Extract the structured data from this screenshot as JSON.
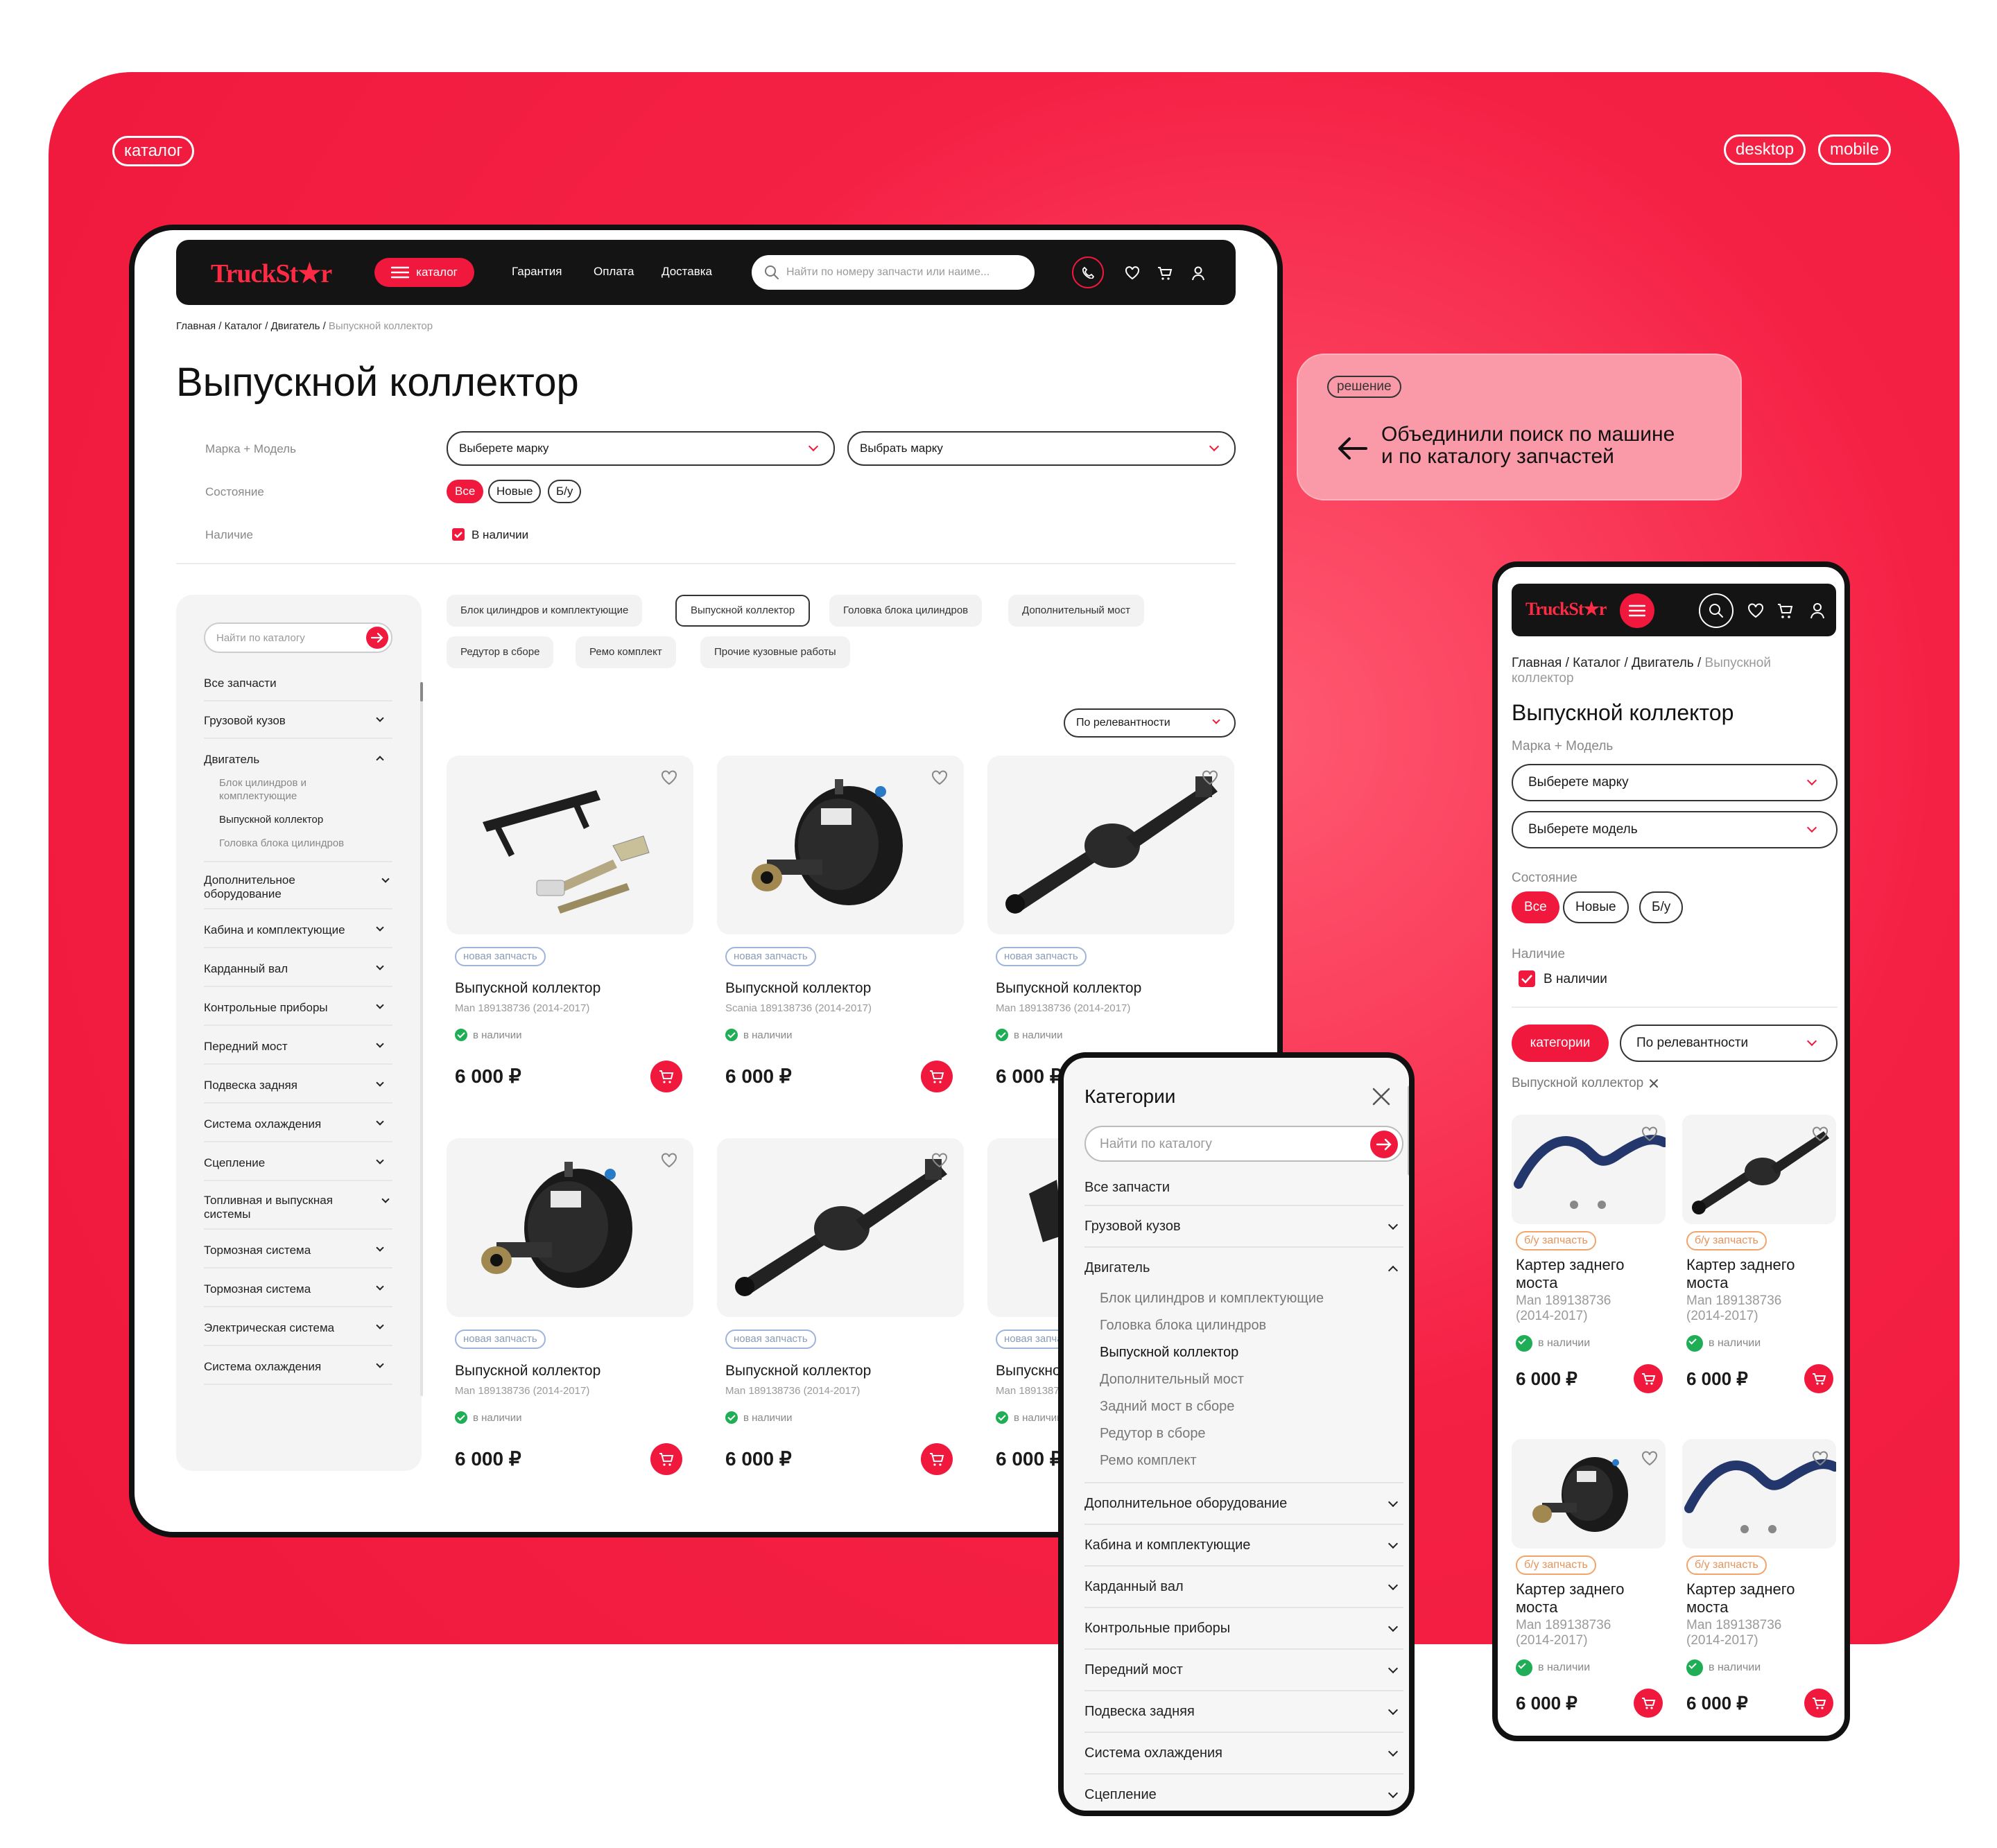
{
  "hero": {
    "tag_catalog": "каталог",
    "tag_desktop": "desktop",
    "tag_mobile": "mobile"
  },
  "callout": {
    "tag": "решение",
    "text_line1": "Объединили поиск по машине",
    "text_line2": "и по каталогу запчастей"
  },
  "brand": {
    "logo": "TruckSt★r",
    "accent": "#f0183c",
    "dark": "#141414"
  },
  "desktop": {
    "header": {
      "catalog_label": "каталог",
      "nav": [
        "Гарантия",
        "Оплата",
        "Доставка"
      ],
      "search_placeholder": "Найти по номеру запчасти или наиме..."
    },
    "breadcrumb": {
      "links": "Главная / Каталог / Двигатель /",
      "current": " Выпускной коллектор"
    },
    "title": "Выпускной коллектор",
    "filters": {
      "brand_model_label": "Марка + Модель",
      "brand_select": "Выберете марку",
      "model_select": "Выбрать марку",
      "condition_label": "Состояние",
      "condition_options": [
        "Все",
        "Новые",
        "Б/у"
      ],
      "availability_label": "Наличие",
      "availability_option": "В наличии"
    },
    "sidebar": {
      "search_placeholder": "Найти по каталогу",
      "all_parts": "Все запчасти",
      "items": [
        "Грузовой кузов",
        "Двигатель",
        "Дополнительное оборудование",
        "Кабина и комплектующие",
        "Карданный вал",
        "Контрольные приборы",
        "Передний мост",
        "Подвеска задняя",
        "Система охлаждения",
        "Сцепление",
        "Топливная и выпускная системы",
        "Тормозная система",
        "Тормозная система",
        "Электрическая система",
        "Система охлаждения"
      ],
      "engine_sub": [
        "Блок цилиндров и комплектующие",
        "Выпускной коллектор",
        "Головка блока цилиндров"
      ]
    },
    "chips": [
      "Блок цилиндров и комплектующие",
      "Выпускной коллектор",
      "Головка блока цилиндров",
      "Дополнительный мост",
      "Редутор в сборе",
      "Ремо комплект",
      "Прочие кузовные работы"
    ],
    "sort": "По релевантности",
    "products": [
      {
        "tag": "новая запчасть",
        "title": "Выпускной коллектор",
        "sub": "Man 189138736 (2014-2017)",
        "avail": "в наличии",
        "price": "6 000 ₽"
      },
      {
        "tag": "новая запчасть",
        "title": "Выпускной коллектор",
        "sub": "Scania 189138736 (2014-2017)",
        "avail": "в наличии",
        "price": "6 000 ₽"
      },
      {
        "tag": "новая запчасть",
        "title": "Выпускной коллектор",
        "sub": "Man 189138736 (2014-2017)",
        "avail": "в наличии",
        "price": "6 000 ₽"
      },
      {
        "tag": "новая запчасть",
        "title": "Выпускной коллектор",
        "sub": "Man 189138736 (2014-2017)",
        "avail": "в наличии",
        "price": "6 000 ₽"
      },
      {
        "tag": "новая запчасть",
        "title": "Выпускной коллектор",
        "sub": "Man 189138736 (2014-2017)",
        "avail": "в наличии",
        "price": "6 000 ₽"
      },
      {
        "tag": "новая запчасть",
        "title": "Выпускной коллектор",
        "sub": "Man 189138736 (2014-2017)",
        "avail": "в наличии",
        "price": "6 000 ₽"
      }
    ]
  },
  "popup": {
    "title": "Категории",
    "search_placeholder": "Найти по каталогу",
    "all_parts": "Все запчасти",
    "items_before": [
      "Грузовой кузов",
      "Двигатель"
    ],
    "engine_sub": [
      "Блок цилиндров и комплектующие",
      "Головка блока цилиндров",
      "Выпускной коллектор",
      "Дополнительный мост",
      "Задний мост в сборе",
      "Редутор в сборе",
      "Ремо комплект"
    ],
    "items_after": [
      "Дополнительное оборудование",
      "Кабина и комплектующие",
      "Карданный вал",
      "Контрольные приборы",
      "Передний мост",
      "Подвеска задняя",
      "Система охлаждения",
      "Сцепление"
    ]
  },
  "mobile": {
    "breadcrumb_links": "Главная / Каталог / Двигатель /",
    "breadcrumb_current": " Выпускной",
    "breadcrumb_current2": "коллектор",
    "title": "Выпускной коллектор",
    "brand_model_label": "Марка + Модель",
    "brand_select": "Выберете марку",
    "model_select": "Выберете модель",
    "condition_label": "Состояние",
    "condition_options": [
      "Все",
      "Новые",
      "Б/у"
    ],
    "availability_label": "Наличие",
    "availability_option": "В наличии",
    "categories_btn": "категории",
    "sort": "По релевантности",
    "active_filter": "Выпускной коллектор",
    "products": [
      {
        "tag": "б/у запчасть",
        "title1": "Картер заднего",
        "title2": "моста",
        "sub1": "Man 189138736",
        "sub2": "(2014-2017)",
        "avail": "в наличии",
        "price": "6 000 ₽"
      },
      {
        "tag": "б/у запчасть",
        "title1": "Картер заднего",
        "title2": "моста",
        "sub1": "Man 189138736",
        "sub2": "(2014-2017)",
        "avail": "в наличии",
        "price": "6 000 ₽"
      },
      {
        "tag": "б/у запчасть",
        "title1": "Картер заднего",
        "title2": "моста",
        "sub1": "Man 189138736",
        "sub2": "(2014-2017)",
        "avail": "в наличии",
        "price": "6 000 ₽"
      },
      {
        "tag": "б/у запчасть",
        "title1": "Картер заднего",
        "title2": "моста",
        "sub1": "Man 189138736",
        "sub2": "(2014-2017)",
        "avail": "в наличии",
        "price": "6 000 ₽"
      }
    ]
  }
}
